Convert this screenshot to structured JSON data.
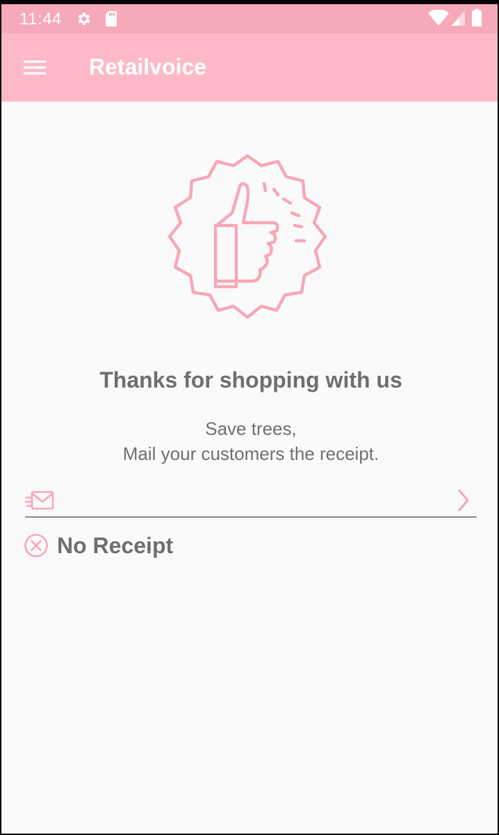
{
  "status_bar": {
    "time": "11:44",
    "icons": [
      "settings-icon",
      "sd-card-icon",
      "wifi-icon",
      "cell-signal-icon",
      "battery-icon"
    ]
  },
  "app_bar": {
    "title": "Retailvoice",
    "menu_icon": "hamburger-menu-icon"
  },
  "hero": {
    "icon": "thumbs-up-badge-icon"
  },
  "main": {
    "headline": "Thanks for shopping with us",
    "subtext_line1": "Save trees,",
    "subtext_line2": "Mail your customers the receipt."
  },
  "email": {
    "value": "",
    "placeholder": "",
    "icon": "mail-icon",
    "submit_icon": "chevron-right-icon"
  },
  "no_receipt": {
    "label": "No Receipt",
    "icon": "circle-x-icon"
  },
  "colors": {
    "status_bar": "#f6a9b9",
    "app_bar": "#fdb9c8",
    "accent": "#f7a7b8",
    "text": "#6f6f6f",
    "background": "#fafafa"
  }
}
